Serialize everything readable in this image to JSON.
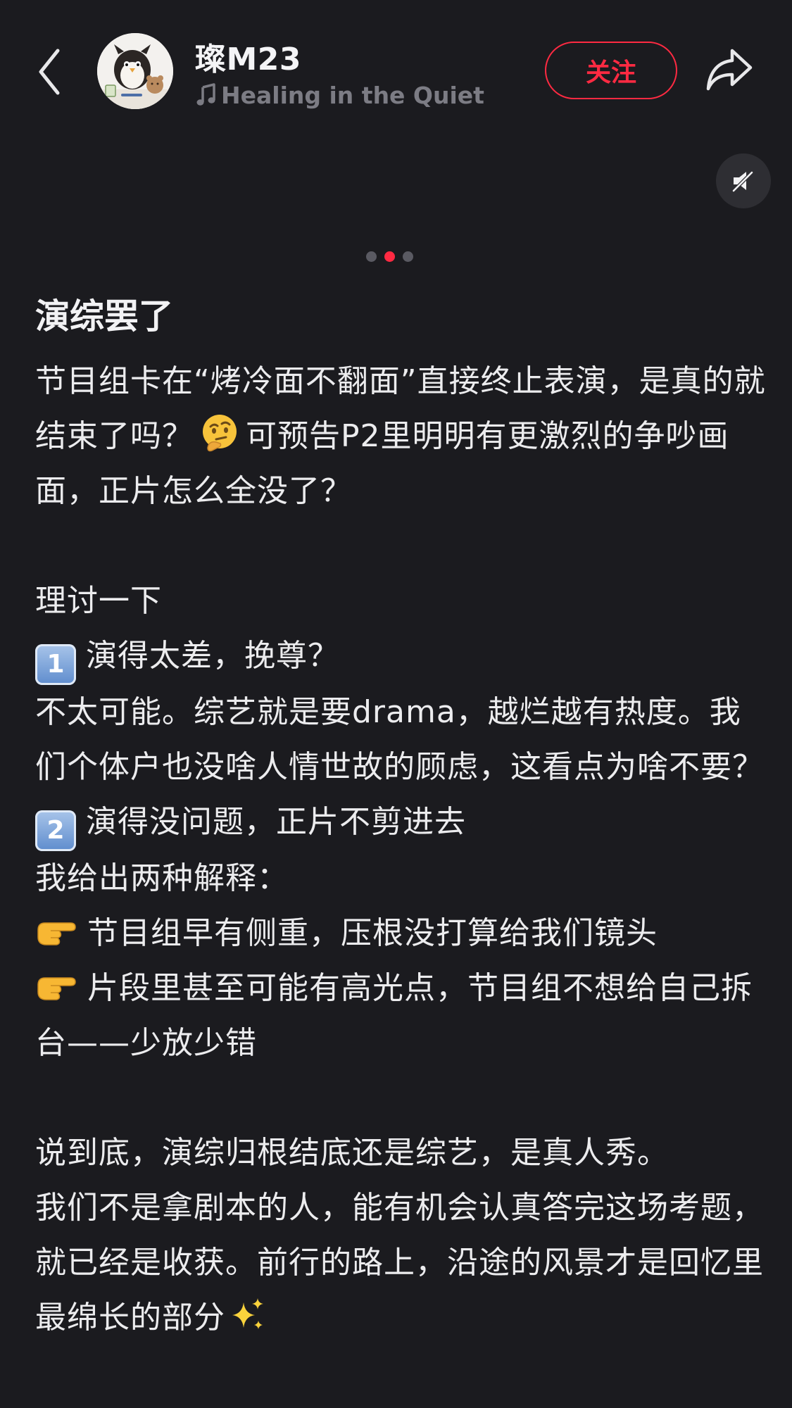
{
  "header": {
    "user_name": "璨M23",
    "music_title": "Healing in the Quiet",
    "follow_label": "关注"
  },
  "icons": {
    "back": "chevron-left-icon",
    "avatar": "penguin-avatar",
    "music": "music-note-icon",
    "share": "share-arrow-icon",
    "mute": "speaker-muted-icon"
  },
  "colors": {
    "background": "#1b1b1f",
    "accent": "#ff2a42",
    "text_primary": "#ececee",
    "text_muted": "#7c7c84"
  },
  "carousel": {
    "count": 3,
    "active_index": 1
  },
  "post": {
    "title": "演综罢了",
    "p1_a": "节目组卡在“烤冷面不翻面”直接终止表演，是真的就结束了吗？",
    "p1_b": "可预告P2里明明有更激烈的争吵画面，正片怎么全没了？",
    "discuss": "理讨一下",
    "item1_number": "1",
    "item1_title": "演得太差，挽尊？",
    "item1_body": "不太可能。综艺就是要drama，越烂越有热度。我们个体户也没啥人情世故的顾虑，这看点为啥不要？",
    "item2_number": "2",
    "item2_title": "演得没问题，正片不剪进去",
    "explain_intro": "我给出两种解释：",
    "bullet1": "节目组早有侧重，压根没打算给我们镜头",
    "bullet2": "片段里甚至可能有高光点，节目组不想给自己拆台——少放少错",
    "conclusion_1": "说到底，演综归根结底还是综艺，是真人秀。",
    "conclusion_2": "我们不是拿剧本的人，能有机会认真答完这场考题，就已经是收获。前行的路上，沿途的风景才是回忆里最绵长的部分"
  }
}
